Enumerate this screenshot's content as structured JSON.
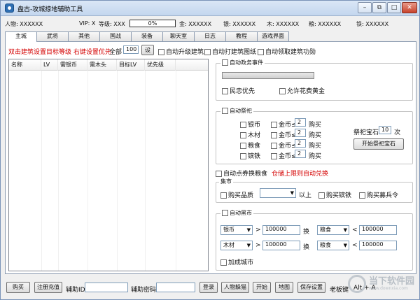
{
  "window": {
    "title": "盘古-攻城掠地辅助工具"
  },
  "info": {
    "role": "人物: XXXXXX",
    "vip": "VIP: X",
    "level": "等级: XXX",
    "progress": "0%",
    "progress_fraction": 0,
    "gold": "金: XXXXXX",
    "silver": "银: XXXXXX",
    "wood": "木: XXXXXX",
    "grain": "粮: XXXXXX",
    "iron": "铁: XXXXXX"
  },
  "tabs": [
    "主城",
    "武将",
    "其他",
    "国战",
    "装备",
    "聊天室",
    "日志",
    "教程",
    "游戏界面"
  ],
  "options": {
    "hint": "双击建筑设置目标等级 右键设置优先",
    "all_label": "全部",
    "all_value": "100",
    "set_label": "设",
    "auto_upgrade": "自动升级建筑",
    "auto_blueprint": "自动打建筑图纸",
    "auto_reward": "自动领取建筑功勋"
  },
  "table": {
    "columns": [
      "名称",
      "LV",
      "需银币",
      "需木头",
      "目标LV",
      "优先级"
    ]
  },
  "affairs": {
    "title": "自动政务事件",
    "opt1": "民忠优先",
    "opt2": "允许花费黄金"
  },
  "sacrifice": {
    "title": "自动祭祀",
    "rows": [
      {
        "res": "银币",
        "gold": "金币≤",
        "val": "2",
        "buy": "购买"
      },
      {
        "res": "木材",
        "gold": "金币≤",
        "val": "2",
        "buy": "购买"
      },
      {
        "res": "粮食",
        "gold": "金币≤",
        "val": "2",
        "buy": "购买"
      },
      {
        "res": "镔铁",
        "gold": "金币≤",
        "val": "2",
        "buy": "购买"
      }
    ],
    "gem_label": "祭祀宝石",
    "gem_value": "10",
    "gem_unit": "次",
    "gem_button": "开始祭祀宝石"
  },
  "exchange": {
    "label": "自动点券换粮食",
    "warn": "仓储上限则自动兑换"
  },
  "market": {
    "title": "集市",
    "buy_quality": "购买品质",
    "quality_value": "",
    "above": "以上",
    "buy_iron": "购买镔铁",
    "buy_order": "购买募兵令"
  },
  "black": {
    "title": "自动黑市",
    "rows": [
      {
        "from": "银币",
        "gt": ">",
        "amount1": "100000",
        "swap": "换",
        "to": "粮食",
        "lt": "<",
        "amount2": "100000"
      },
      {
        "from": "木材",
        "gt": ">",
        "amount1": "100000",
        "swap": "换",
        "to": "粮食",
        "lt": "<",
        "amount2": "100000"
      }
    ],
    "city": "加成城市"
  },
  "bottom": {
    "buy": "购买",
    "register": "注册充值",
    "id_label": "辅助ID",
    "id_value": "",
    "pwd_label": "辅助密码",
    "pwd_value": "",
    "login": "登录",
    "hide": "人物躲猫",
    "start": "开始",
    "map": "地图",
    "save": "保存设置",
    "boss": "老板键",
    "hotkey": "Alt + A"
  },
  "watermark": {
    "text": "当下软件园",
    "sub": "www.downxia.com"
  },
  "icons": [
    "app-icon",
    "minimize-icon",
    "restore-icon",
    "maximize-icon",
    "close-icon",
    "dropdown-icon"
  ]
}
